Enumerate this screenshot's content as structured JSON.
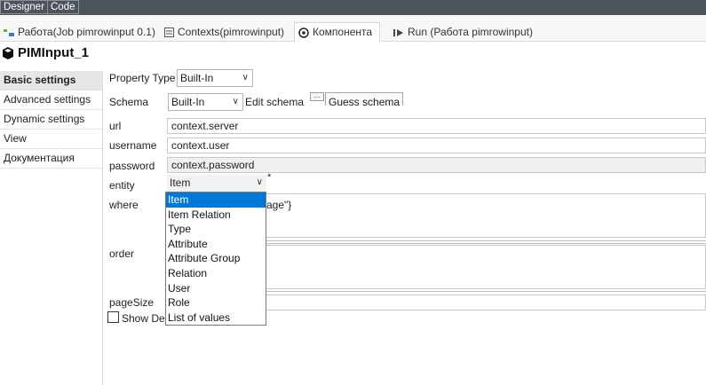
{
  "topbar": {
    "designer": "Designer",
    "code": "Code"
  },
  "tabs": [
    {
      "label": "Работа(Job pimrowinput 0.1)",
      "icon": "job-icon"
    },
    {
      "label": "Contexts(pimrowinput)",
      "icon": "contexts-icon"
    },
    {
      "label": "Компонента",
      "icon": "component-icon"
    },
    {
      "label": "Run (Работа pimrowinput)",
      "icon": "run-icon"
    }
  ],
  "title": "PIMInput_1",
  "nav": [
    "Basic settings",
    "Advanced settings",
    "Dynamic settings",
    "View",
    "Документация"
  ],
  "form": {
    "property_type_label": "Property Type",
    "property_type_value": "Built-In",
    "schema_label": "Schema",
    "schema_value": "Built-In",
    "edit_schema": "Edit schema",
    "small_button": "...",
    "guess_schema": "Guess schema",
    "url_label": "url",
    "url_value": "context.server",
    "username_label": "username",
    "username_value": "context.user",
    "password_label": "password",
    "password_value": "context.password",
    "entity_label": "entity",
    "entity_value": "Item",
    "entity_required": "*",
    "where_label": "where",
    "where_value_visible": "age\"}",
    "order_label": "order",
    "pagesize_label": "pageSize",
    "show_debug_label": "Show Deb"
  },
  "dropdown": {
    "options": [
      "Item",
      "Item Relation",
      "Type",
      "Attribute",
      "Attribute Group",
      "Relation",
      "User",
      "Role",
      "List of values"
    ],
    "selected": "Item"
  },
  "colors": {
    "selection": "#0078d7",
    "topbar": "#4d535b"
  }
}
